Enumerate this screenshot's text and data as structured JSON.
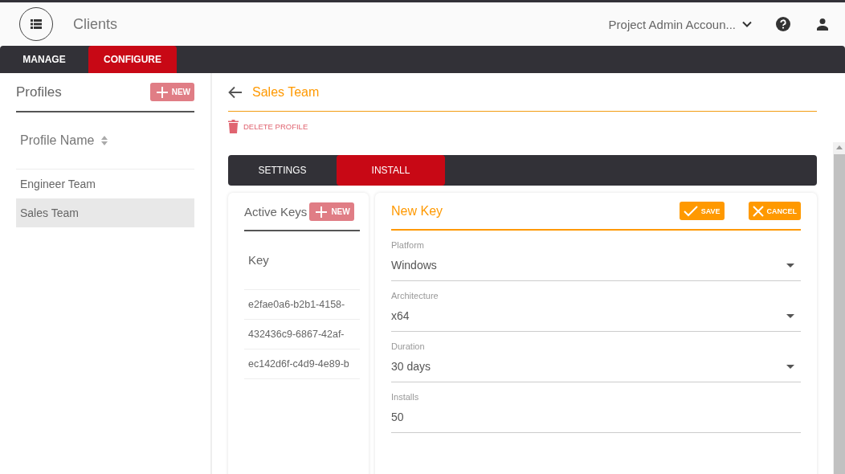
{
  "header": {
    "title": "Clients",
    "account": "Project Admin Accoun..."
  },
  "nav_tabs": [
    {
      "label": "MANAGE",
      "selected": false
    },
    {
      "label": "CONFIGURE",
      "selected": true
    }
  ],
  "sidebar": {
    "title": "Profiles",
    "new_button": "NEW",
    "column": "Profile Name",
    "items": [
      {
        "label": "Engineer Team",
        "selected": false
      },
      {
        "label": "Sales Team",
        "selected": true
      }
    ]
  },
  "profile": {
    "title": "Sales Team",
    "delete_link": "DELETE PROFILE"
  },
  "section_tabs": [
    {
      "label": "SETTINGS",
      "selected": false
    },
    {
      "label": "INSTALL",
      "selected": true
    }
  ],
  "active_keys": {
    "title": "Active Keys",
    "new_button": "NEW",
    "column": "Key",
    "rows": [
      "e2fae0a6-b2b1-4158-",
      "432436c9-6867-42af-",
      "ec142d6f-c4d9-4e89-b"
    ]
  },
  "new_key": {
    "title": "New Key",
    "save_button": "SAVE",
    "cancel_button": "CANCEL",
    "fields": [
      {
        "kind": "select",
        "label": "Platform",
        "value": "Windows"
      },
      {
        "kind": "select",
        "label": "Architecture",
        "value": "x64"
      },
      {
        "kind": "select",
        "label": "Duration",
        "value": "30 days"
      },
      {
        "kind": "text",
        "label": "Installs",
        "value": "50"
      }
    ]
  }
}
